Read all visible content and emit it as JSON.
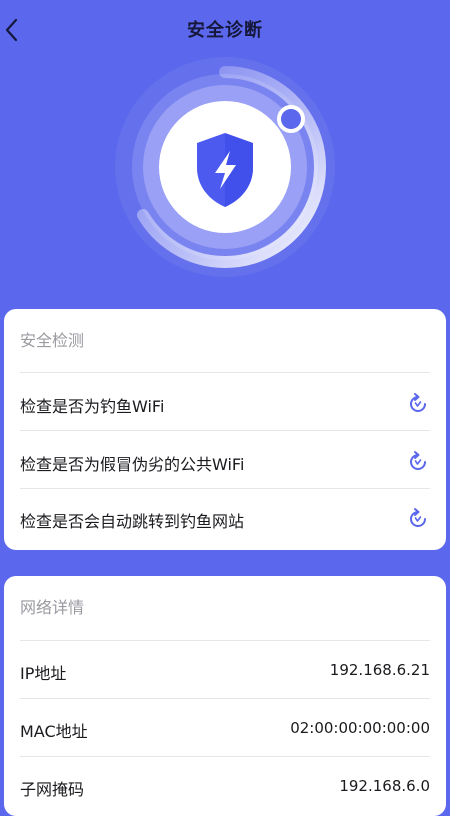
{
  "header": {
    "title": "安全诊断"
  },
  "icons": {
    "back": "chevron-left-icon",
    "shield": "shield-lightning-icon",
    "refresh": "refresh-icon"
  },
  "colors": {
    "background": "#5b67ec",
    "accent": "#4c5af0",
    "card": "#ffffff"
  },
  "security_check": {
    "title": "安全检测",
    "items": [
      {
        "label": "检查是否为钓鱼WiFi"
      },
      {
        "label": "检查是否为假冒伪劣的公共WiFi"
      },
      {
        "label": "检查是否会自动跳转到钓鱼网站"
      }
    ]
  },
  "network_details": {
    "title": "网络详情",
    "rows": [
      {
        "label": "IP地址",
        "value": "192.168.6.21"
      },
      {
        "label": "MAC地址",
        "value": "02:00:00:00:00:00"
      },
      {
        "label": "子网掩码",
        "value": "192.168.6.0"
      }
    ]
  }
}
